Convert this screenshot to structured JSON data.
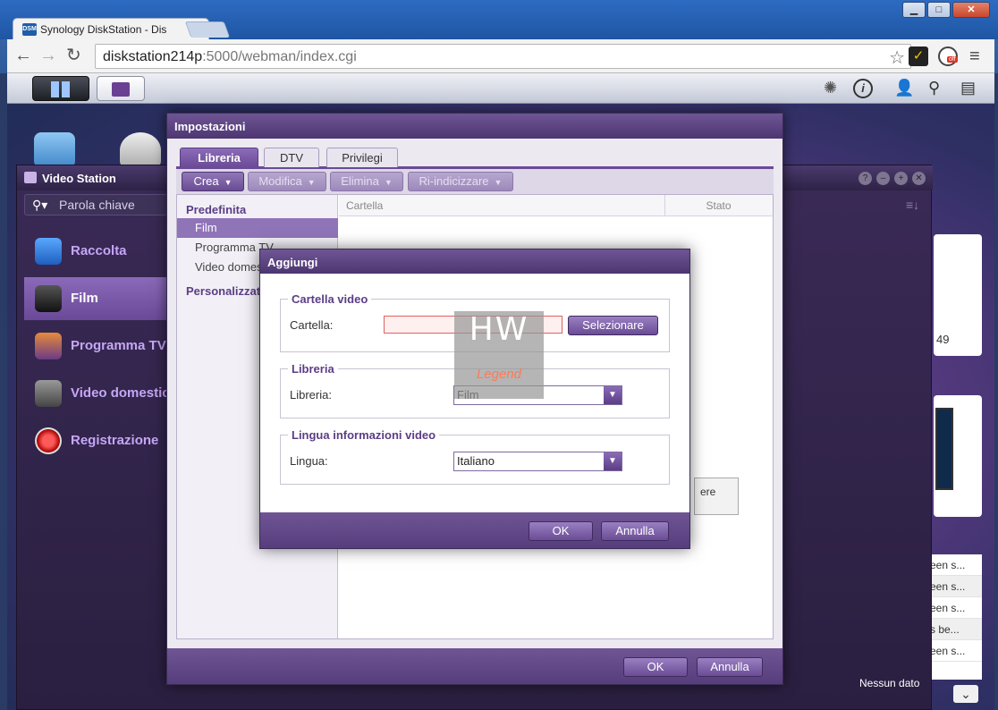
{
  "browser": {
    "tab_title": "Synology DiskStation - Dis",
    "favicon_text": "DSM",
    "url_host": "diskstation214p",
    "url_path": ":5000/webman/index.cgi",
    "ghostery_badge": "off"
  },
  "desktop": {
    "widget_number": "49",
    "log_rows": [
      "een s...",
      "een s...",
      "een s...",
      "s be...",
      "een s..."
    ],
    "no_data": "Nessun dato"
  },
  "video_station": {
    "title": "Video Station",
    "search_placeholder": "Parola chiave",
    "nav": [
      "Raccolta",
      "Film",
      "Programma TV",
      "Video domestici",
      "Registrazione"
    ]
  },
  "settings": {
    "title": "Impostazioni",
    "tabs": [
      "Libreria",
      "DTV",
      "Privilegi"
    ],
    "toolbar": {
      "crea": "Crea",
      "modifica": "Modifica",
      "elimina": "Elimina",
      "reindex": "Ri-indicizzare"
    },
    "tree": {
      "default_header": "Predefinita",
      "items": [
        "Film",
        "Programma TV",
        "Video domestici"
      ],
      "custom_header": "Personalizzata"
    },
    "columns": {
      "folder": "Cartella",
      "status": "Stato"
    },
    "background_button_fragment": "ere",
    "ok": "OK",
    "cancel": "Annulla"
  },
  "add_dialog": {
    "title": "Aggiungi",
    "video_folder_legend": "Cartella video",
    "folder_label": "Cartella:",
    "folder_value": "",
    "select_button": "Selezionare",
    "library_legend": "Libreria",
    "library_label": "Libreria:",
    "library_value": "Film",
    "language_legend": "Lingua informazioni video",
    "language_label": "Lingua:",
    "language_value": "Italiano",
    "ok": "OK",
    "cancel": "Annulla"
  },
  "watermark": {
    "big": "HW",
    "small": "Legend"
  }
}
